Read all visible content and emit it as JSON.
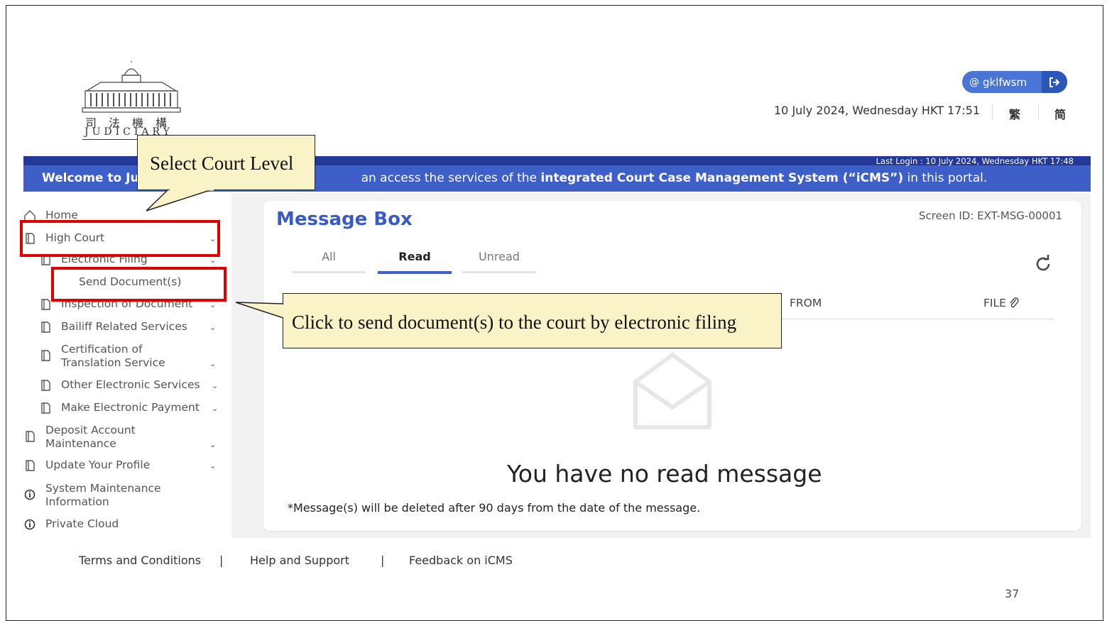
{
  "header": {
    "logo_cn": "司法機構",
    "logo_en": "JUDICIARY",
    "user": "gklfwsm",
    "datetime": "10 July 2024, Wednesday HKT 17:51",
    "lang_trad": "繁",
    "lang_simp": "简"
  },
  "banner": {
    "last_login": "Last Login : 10 July 2024, Wednesday HKT 17:48",
    "welcome_start": "Welcome to Ju",
    "welcome_mid": "an access the services of the ",
    "welcome_bold": "integrated Court Case Management System (“iCMS”)",
    "welcome_end": " in this portal."
  },
  "sidebar": {
    "home": "Home",
    "high_court": "High Court",
    "electronic_filing": "Electronic Filing",
    "send_documents": "Send Document(s)",
    "inspection": "Inspection of Document",
    "bailiff": "Bailiff Related Services",
    "certification_1": "Certification of",
    "certification_2": "Translation Service",
    "other_electronic": "Other Electronic Services",
    "make_payment": "Make Electronic Payment",
    "deposit_1": "Deposit Account",
    "deposit_2": "Maintenance",
    "update_profile": "Update Your Profile",
    "system_1": "System Maintenance",
    "system_2": "Information",
    "private_cloud": "Private Cloud"
  },
  "main": {
    "title": "Message Box",
    "screen_id": "Screen ID: EXT-MSG-00001",
    "tabs": [
      "All",
      "Read",
      "Unread"
    ],
    "active_tab": "Read",
    "col_from": "FROM",
    "col_file": "FILE",
    "empty_message": "You have no read message",
    "note": "*Message(s) will be deleted after 90 days from the date of the message."
  },
  "footer": {
    "terms": "Terms and Conditions",
    "help": "Help and Support",
    "feedback": "Feedback on iCMS",
    "separator": "|"
  },
  "annotations": {
    "callout_court_level": "Select Court Level",
    "callout_send": "Click to send document(s) to the court by electronic filing"
  },
  "page_number": "37",
  "colors": {
    "accent": "#3a5bc4",
    "banner": "#3e5fc7",
    "highlight": "#e00000",
    "callout_bg": "#fbf3c8"
  },
  "icons": [
    "home-icon",
    "document-icon",
    "info-icon",
    "chevron-down-icon",
    "refresh-icon",
    "paperclip-icon",
    "envelope-open-icon",
    "logout-icon",
    "user-icon"
  ]
}
